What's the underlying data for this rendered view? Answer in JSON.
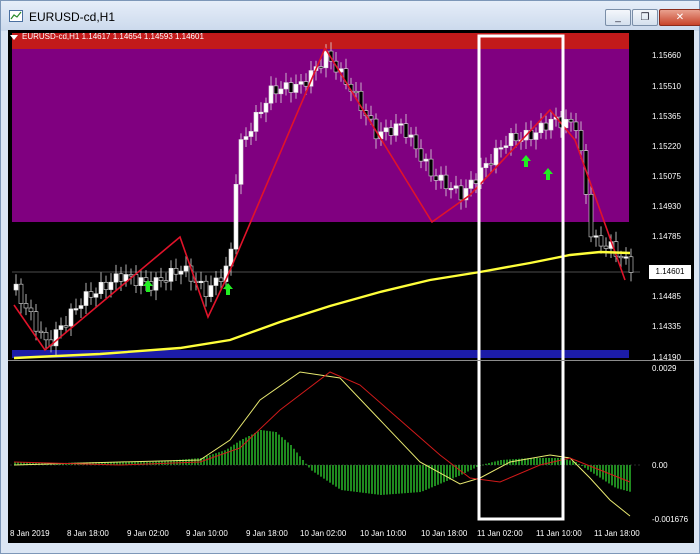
{
  "window": {
    "title": "EURUSD-cd,H1",
    "minimize_glyph": "_",
    "restore_glyph": "❐",
    "close_glyph": "✕"
  },
  "chart_header": "EURUSD-cd,H1  1.14617 1.14654 1.14593 1.14601",
  "price_scale": [
    "1.15660",
    "1.15510",
    "1.15365",
    "1.15220",
    "1.15075",
    "1.14930",
    "1.14785",
    "1.14485",
    "1.14335",
    "1.14190"
  ],
  "current_price": "1.14601",
  "macd_scale": [
    "0.0029",
    "0.00",
    "-0.001676"
  ],
  "time_axis": [
    "8 Jan 2019",
    "8 Jan 18:00",
    "9 Jan 02:00",
    "9 Jan 10:00",
    "9 Jan 18:00",
    "10 Jan 02:00",
    "10 Jan 10:00",
    "10 Jan 18:00",
    "11 Jan 02:00",
    "11 Jan 10:00",
    "11 Jan 18:00"
  ],
  "colors": {
    "zone_top": "#c21a1a",
    "zone_mid": "#800080",
    "zone_bottom": "#1c1ca8",
    "zigzag": "#e0132a",
    "moving_average": "#ffff3a",
    "bull_candle": "#ffffff",
    "bear_candle": "#000000",
    "signal_arrow": "#22ee22",
    "macd_histogram": "#1f8a1f",
    "macd_main": "#e8e870",
    "macd_signal": "#d01a1a",
    "highlight_box": "#ffffff"
  },
  "icons": {
    "signal": "green-up-arrow-icon",
    "app": "chart-window-icon"
  }
}
